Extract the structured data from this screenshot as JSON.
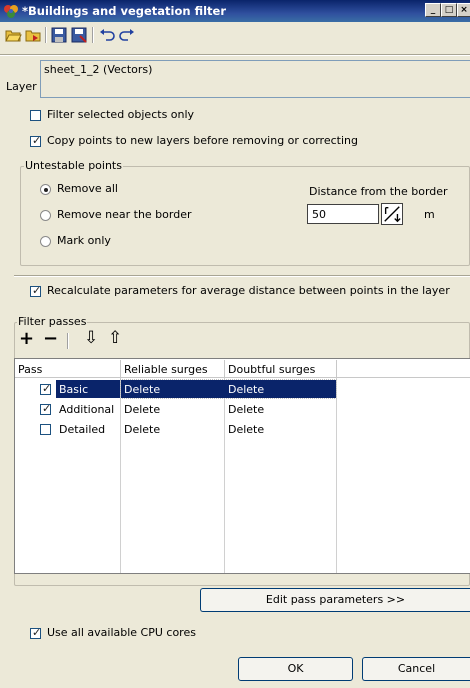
{
  "window": {
    "title": "*Buildings and vegetation filter",
    "controls": [
      "_",
      "□",
      "×"
    ]
  },
  "toolbar": {
    "icons": [
      "open-folder-icon",
      "open-as-icon",
      "save-icon",
      "save-as-icon",
      "undo-icon",
      "redo-icon"
    ]
  },
  "layer": {
    "label": "Layer",
    "value": "sheet_1_2 (Vectors)"
  },
  "options": {
    "filter_selected": {
      "label": "Filter selected objects only",
      "checked": false
    },
    "copy_points": {
      "label": "Copy points to new layers before removing or correcting",
      "checked": true
    }
  },
  "untestable": {
    "title": "Untestable points",
    "radios": [
      {
        "label": "Remove all",
        "selected": true
      },
      {
        "label": "Remove near the border",
        "selected": false
      },
      {
        "label": "Mark only",
        "selected": false
      }
    ],
    "distance_label": "Distance from the border",
    "distance_value": "50",
    "distance_unit": "m"
  },
  "recalculate": {
    "label": "Recalculate parameters for average distance between points in the layer",
    "checked": true
  },
  "passes": {
    "title": "Filter passes",
    "tools": {
      "add": "+",
      "remove": "−",
      "down": "⇩",
      "up": "⇧"
    },
    "columns": [
      "Pass",
      "Reliable surges",
      "Doubtful surges"
    ],
    "rows": [
      {
        "pass": "Basic",
        "checked": true,
        "reliable": "Delete",
        "doubtful": "Delete",
        "selected": true
      },
      {
        "pass": "Additional",
        "checked": true,
        "reliable": "Delete",
        "doubtful": "Delete",
        "selected": false
      },
      {
        "pass": "Detailed",
        "checked": false,
        "reliable": "Delete",
        "doubtful": "Delete",
        "selected": false
      }
    ]
  },
  "edit_pass_button": "Edit pass parameters >>",
  "cpu": {
    "label": "Use all available CPU cores",
    "checked": true
  },
  "buttons": {
    "ok": "OK",
    "cancel": "Cancel"
  },
  "colors": {
    "titlebar": "#0a246a",
    "selection": "#0a246a",
    "dialog_bg": "#ece9d8"
  }
}
